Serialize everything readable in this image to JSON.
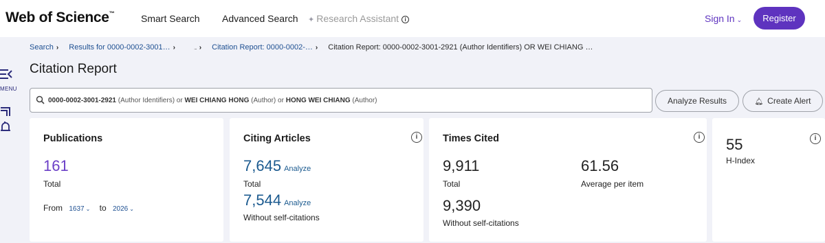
{
  "nav": {
    "brand": "Web of Science",
    "brand_tm": "™",
    "smart_search": "Smart Search",
    "advanced_search": "Advanced Search",
    "research_assistant": "Research Assistant",
    "sign_in": "Sign In",
    "register": "Register"
  },
  "rail": {
    "menu_label": "MENU"
  },
  "breadcrumbs": {
    "items": [
      "Search",
      "Results for 0000-0002-3001…",
      "...",
      "Citation Report: 0000-0002-…",
      "Citation Report: 0000-0002-3001-2921 (Author Identifiers) OR WEI CHIANG …"
    ]
  },
  "page": {
    "title": "Citation Report"
  },
  "query": {
    "term1": "0000-0002-3001-2921",
    "field1": " (Author Identifiers) or ",
    "term2": "WEI CHIANG HONG",
    "field2": " (Author) or ",
    "term3": "HONG WEI CHIANG",
    "field3": " (Author)"
  },
  "actions": {
    "analyze_results": "Analyze Results",
    "create_alert": "Create Alert"
  },
  "publications": {
    "title": "Publications",
    "total": "161",
    "total_label": "Total",
    "from_label": "From",
    "from_year": "1637",
    "to_label": "to",
    "to_year": "2026"
  },
  "citing_articles": {
    "title": "Citing Articles",
    "total": "7,645",
    "total_label": "Total",
    "without_self": "7,544",
    "without_self_label": "Without self-citations",
    "analyze": "Analyze"
  },
  "times_cited": {
    "title": "Times Cited",
    "total": "9,911",
    "total_label": "Total",
    "average": "61.56",
    "average_label": "Average per item",
    "without_self": "9,390",
    "without_self_label": "Without self-citations"
  },
  "h_index": {
    "value": "55",
    "label": "H-Index"
  },
  "colors": {
    "brand_purple": "#5e33bf",
    "link_blue": "#1d4f91",
    "background": "#f1f2f8"
  }
}
